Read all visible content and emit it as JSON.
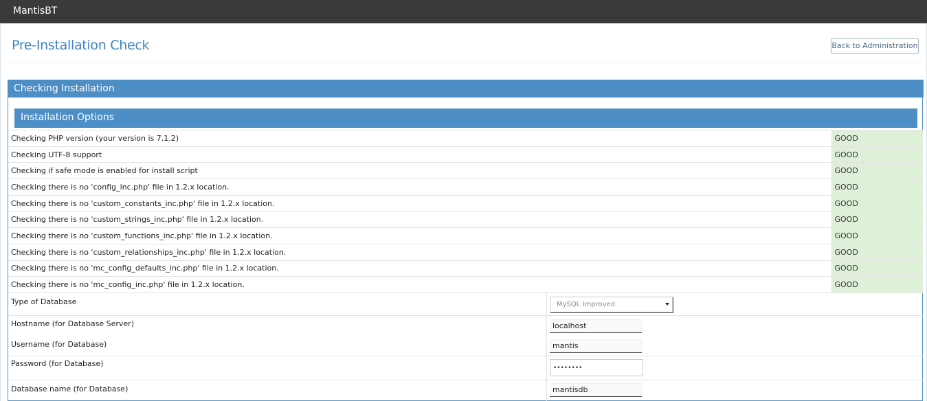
{
  "app": {
    "brand": "MantisBT"
  },
  "page": {
    "title": "Pre-Installation Check",
    "back_button": "Back to Administration"
  },
  "widget": {
    "title": "Checking Installation",
    "section_title": "Installation Options"
  },
  "checks": [
    {
      "label": "Checking PHP version (your version is 7.1.2)",
      "status": "GOOD"
    },
    {
      "label": "Checking UTF-8 support",
      "status": "GOOD"
    },
    {
      "label": "Checking if safe mode is enabled for install script",
      "status": "GOOD"
    },
    {
      "label": "Checking there is no 'config_inc.php' file in 1.2.x location.",
      "status": "GOOD"
    },
    {
      "label": "Checking there is no 'custom_constants_inc.php' file in 1.2.x location.",
      "status": "GOOD"
    },
    {
      "label": "Checking there is no 'custom_strings_inc.php' file in 1.2.x location.",
      "status": "GOOD"
    },
    {
      "label": "Checking there is no 'custom_functions_inc.php' file in 1.2.x location.",
      "status": "GOOD"
    },
    {
      "label": "Checking there is no 'custom_relationships_inc.php' file in 1.2.x location.",
      "status": "GOOD"
    },
    {
      "label": "Checking there is no 'mc_config_defaults_inc.php' file in 1.2.x location.",
      "status": "GOOD"
    },
    {
      "label": "Checking there is no 'mc_config_inc.php' file in 1.2.x location.",
      "status": "GOOD"
    }
  ],
  "form": {
    "db_type_label": "Type of Database",
    "db_type_value": "MySQL Improved",
    "hostname_label": "Hostname (for Database Server)",
    "hostname_value": "localhost",
    "username_label": "Username (for Database)",
    "username_value": "mantis",
    "password_label": "Password (for Database)",
    "password_value": "••••••••",
    "dbname_label": "Database name (for Database)",
    "dbname_value": "mantisdb"
  },
  "colors": {
    "navbar": "#3a3a3a",
    "header_blue": "#4e8ec7",
    "title_blue": "#3c83c2",
    "good_green": "#dff0d8"
  }
}
